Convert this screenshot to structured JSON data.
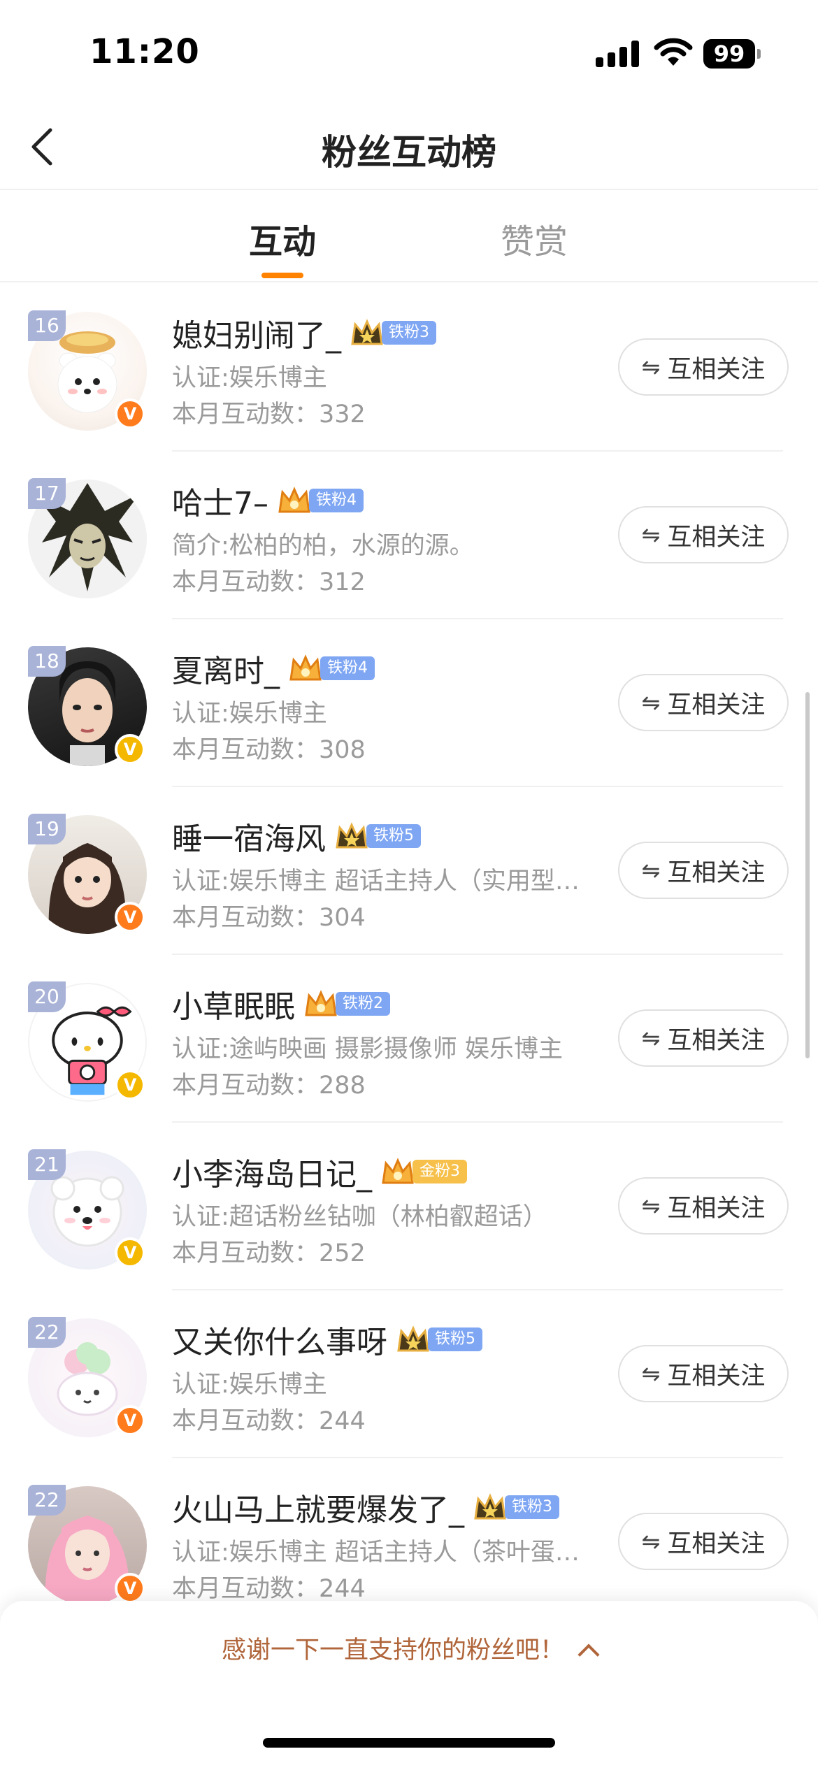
{
  "status_bar": {
    "time": "11:20",
    "battery": "99"
  },
  "nav": {
    "title": "粉丝互动榜"
  },
  "tabs": [
    {
      "label": "互动"
    },
    {
      "label": "赞赏"
    }
  ],
  "follow_icon": "⇋",
  "list": [
    {
      "rank": "16",
      "name": "媳妇别闹了_",
      "fan_tag": "铁粉3",
      "desc": "认证:娱乐博主",
      "count": "本月互动数：332",
      "follow": "互相关注",
      "verified": "orange"
    },
    {
      "rank": "17",
      "name": "哈士7–",
      "fan_tag": "铁粉4",
      "desc": "简介:松柏的柏，水源的源。",
      "count": "本月互动数：312",
      "follow": "互相关注",
      "verified": ""
    },
    {
      "rank": "18",
      "name": "夏离时_",
      "fan_tag": "铁粉4",
      "desc": "认证:娱乐博主",
      "count": "本月互动数：308",
      "follow": "互相关注",
      "verified": "gold"
    },
    {
      "rank": "19",
      "name": "睡一宿海风",
      "fan_tag": "铁粉5",
      "desc": "认证:娱乐博主 超话主持人（实用型…",
      "count": "本月互动数：304",
      "follow": "互相关注",
      "verified": "orange"
    },
    {
      "rank": "20",
      "name": "小草眠眠",
      "fan_tag": "铁粉2",
      "desc": "认证:途屿映画 摄影摄像师 娱乐博主",
      "count": "本月互动数：288",
      "follow": "互相关注",
      "verified": "gold"
    },
    {
      "rank": "21",
      "name": "小李海岛日记_",
      "fan_tag": "金粉3",
      "desc": "认证:超话粉丝钻咖（林柏叡超话）",
      "count": "本月互动数：252",
      "follow": "互相关注",
      "verified": "gold"
    },
    {
      "rank": "22",
      "name": "又关你什么事呀",
      "fan_tag": "铁粉5",
      "desc": "认证:娱乐博主",
      "count": "本月互动数：244",
      "follow": "互相关注",
      "verified": "orange"
    },
    {
      "rank": "22",
      "name": "火山马上就要爆发了_",
      "fan_tag": "铁粉3",
      "desc": "认证:娱乐博主 超话主持人（茶叶蛋…",
      "count": "本月互动数：244",
      "follow": "互相关注",
      "verified": "orange"
    }
  ],
  "bottom": {
    "thanks": "感谢一下一直支持你的粉丝吧！"
  },
  "colors": {
    "accent": "#ff8200",
    "iron_tag": "#7ea6f3",
    "gold_tag": "#f6c04a",
    "rank_badge": "#a9b3d8"
  }
}
